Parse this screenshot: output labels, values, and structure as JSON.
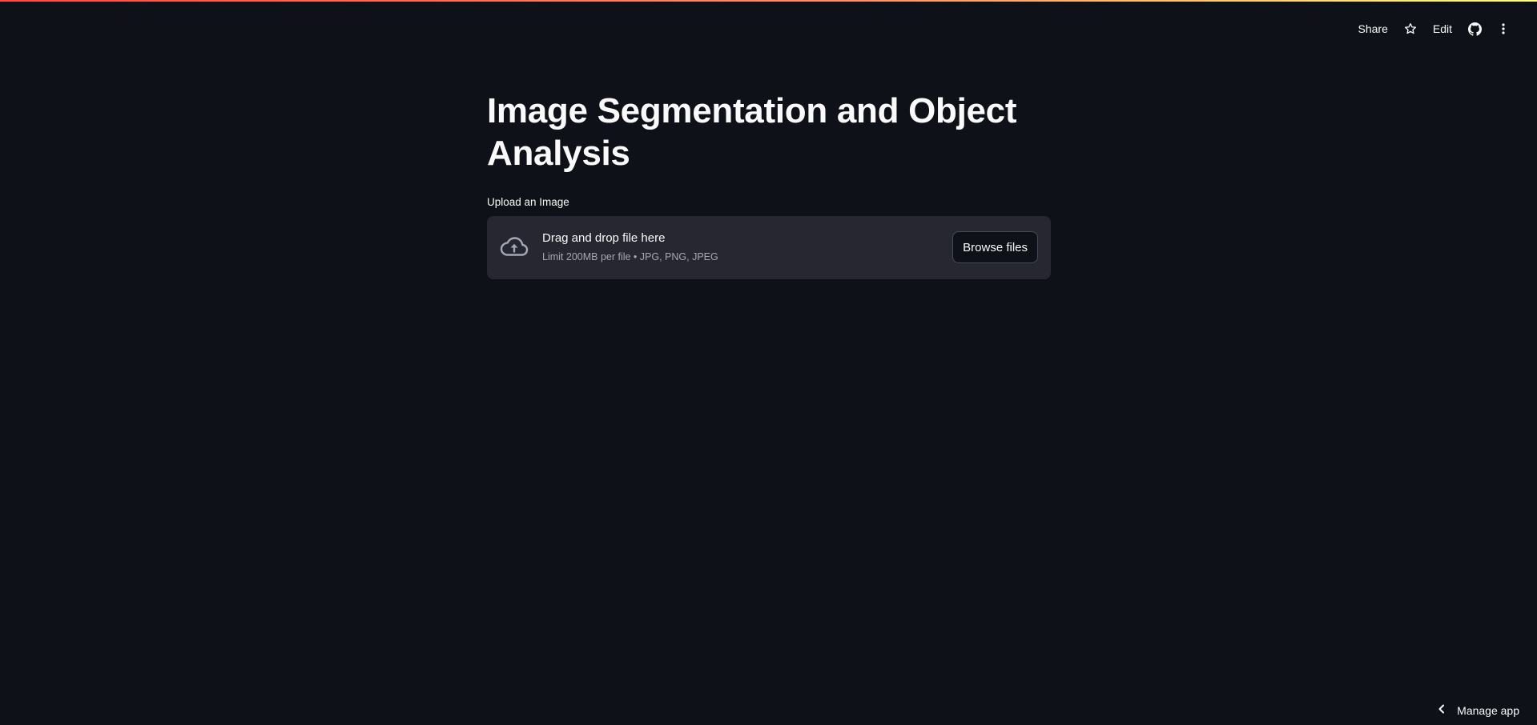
{
  "toolbar": {
    "share_label": "Share",
    "edit_label": "Edit",
    "icons": [
      "star-icon",
      "github-icon",
      "more-vertical-icon"
    ]
  },
  "main": {
    "title": "Image Segmentation and Object Analysis",
    "uploader": {
      "label": "Upload an Image",
      "drop_text": "Drag and drop file here",
      "limit_text": "Limit 200MB per file • JPG, PNG, JPEG",
      "browse_label": "Browse files",
      "icon": "cloud-upload-icon"
    }
  },
  "footer": {
    "manage_app_label": "Manage app",
    "icon": "chevron-left-icon"
  },
  "colors": {
    "background": "#0e1117",
    "surface": "#262730",
    "text": "#fafafa",
    "muted_text": "#a3a8b8",
    "accent_gradient_start": "#ff4b4b",
    "accent_gradient_end": "#fffd80"
  }
}
